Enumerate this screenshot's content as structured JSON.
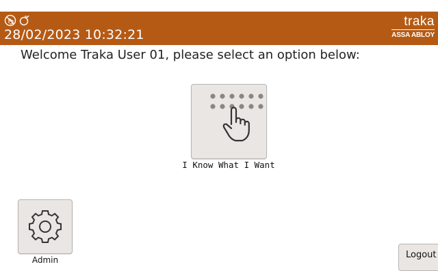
{
  "header": {
    "datetime": "28/02/2023 10:32:21",
    "brand_name": "traka",
    "brand_sub": "ASSA ABLOY",
    "status_icons": [
      "no-touch-icon",
      "plug-icon"
    ]
  },
  "main": {
    "welcome": "Welcome Traka User 01, please select an option below:",
    "primary_option": {
      "label": "I Know What I Want",
      "icon": "keypad-touch-icon"
    },
    "admin_option": {
      "label": "Admin",
      "icon": "gear-icon"
    },
    "logout_label": "Logout"
  },
  "colors": {
    "header_bg": "#b55a14",
    "tile_bg": "#e9e6e3",
    "icon_gray": "#8a8684"
  }
}
